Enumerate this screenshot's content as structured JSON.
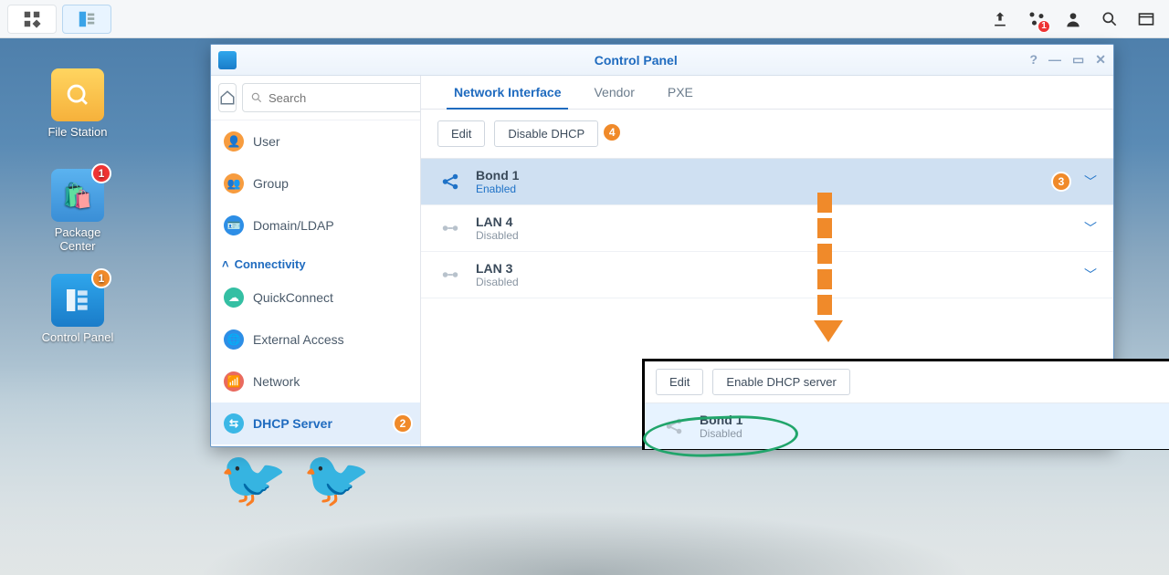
{
  "taskbar": {
    "badge": "1"
  },
  "desktop": {
    "fileStation": "File Station",
    "packageCenter": "Package\nCenter",
    "packageBadge": "1",
    "controlPanel": "Control Panel",
    "controlPanelBadge": "1"
  },
  "window": {
    "title": "Control Panel"
  },
  "search": {
    "placeholder": "Search"
  },
  "sidebar": {
    "items": [
      "User",
      "Group",
      "Domain/LDAP"
    ],
    "section": "Connectivity",
    "conn": [
      "QuickConnect",
      "External Access",
      "Network",
      "DHCP Server"
    ],
    "dhcpBadge": "2"
  },
  "tabs": {
    "networkInterface": "Network Interface",
    "vendor": "Vendor",
    "pxe": "PXE"
  },
  "toolbar": {
    "edit": "Edit",
    "disableDhcp": "Disable DHCP",
    "disableBadge": "4",
    "enableDhcp": "Enable DHCP server"
  },
  "interfaces": [
    {
      "name": "Bond 1",
      "status": "Enabled",
      "enabled": true,
      "badge": "3"
    },
    {
      "name": "LAN 4",
      "status": "Disabled",
      "enabled": false
    },
    {
      "name": "LAN 3",
      "status": "Disabled",
      "enabled": false
    }
  ],
  "callout": {
    "name": "Bond 1",
    "status": "Disabled"
  }
}
